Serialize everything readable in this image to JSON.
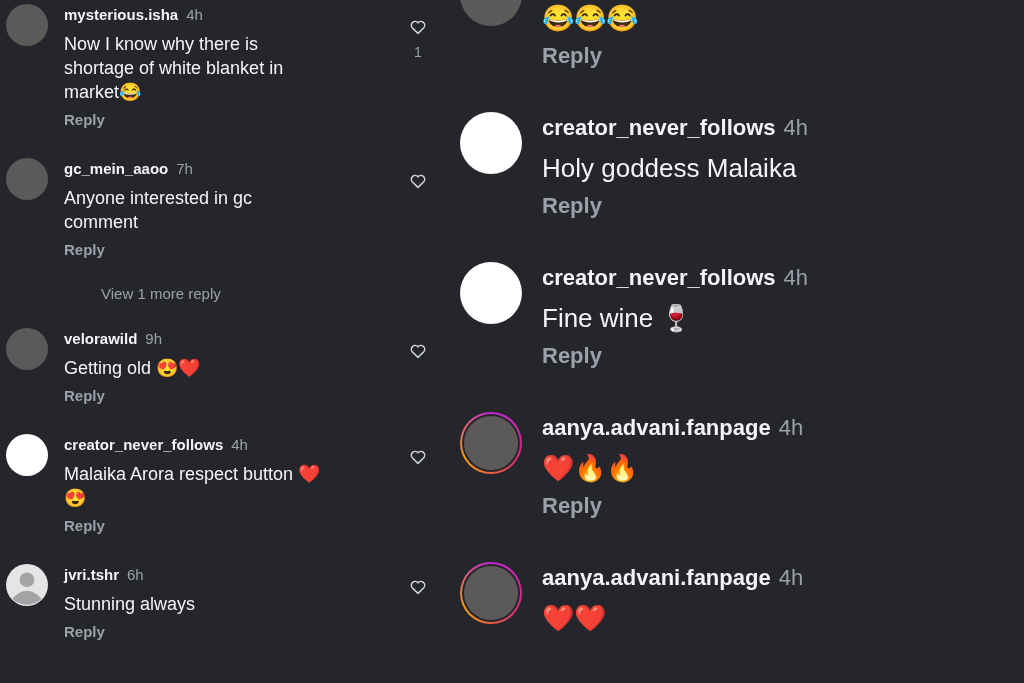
{
  "left_column": {
    "items": [
      {
        "kind": "comment",
        "username": "mysterious.isha",
        "time": "4h",
        "avatar": {
          "kind": "photo",
          "story_ring": false
        },
        "lines": [
          "Now I know why there is",
          "shortage of white blanket in",
          "market😂"
        ],
        "reply": "Reply",
        "liked": false,
        "like_count": "1"
      },
      {
        "kind": "comment",
        "username": "gc_mein_aaoo",
        "time": "7h",
        "avatar": {
          "kind": "photo",
          "story_ring": false
        },
        "lines": [
          "Anyone interested in gc",
          "comment"
        ],
        "reply": "Reply",
        "liked": false
      },
      {
        "kind": "more_replies",
        "text": "View 1 more reply"
      },
      {
        "kind": "comment",
        "username": "velorawild",
        "time": "9h",
        "avatar": {
          "kind": "photo",
          "story_ring": false
        },
        "lines": [
          "Getting old 😍❤️"
        ],
        "reply": "Reply",
        "liked": false
      },
      {
        "kind": "comment",
        "username": "creator_never_follows",
        "time": "4h",
        "avatar": {
          "kind": "blank",
          "story_ring": false
        },
        "lines": [
          "Malaika Arora respect button ❤️",
          "😍"
        ],
        "reply": "Reply",
        "liked": false
      },
      {
        "kind": "comment",
        "username": "jvri.tshr",
        "time": "6h",
        "avatar": {
          "kind": "default",
          "story_ring": false
        },
        "lines": [
          "Stunning always"
        ],
        "reply": "Reply",
        "liked": false
      }
    ]
  },
  "right_column": {
    "items": [
      {
        "kind": "comment",
        "avatar": {
          "kind": "photo",
          "story_ring": false
        },
        "lines": [
          "😂😂😂"
        ],
        "reply": "Reply"
      },
      {
        "kind": "comment",
        "username": "creator_never_follows",
        "time": "4h",
        "avatar": {
          "kind": "blank",
          "story_ring": false
        },
        "lines": [
          "Holy goddess Malaika"
        ],
        "reply": "Reply"
      },
      {
        "kind": "comment",
        "username": "creator_never_follows",
        "time": "4h",
        "avatar": {
          "kind": "blank",
          "story_ring": false
        },
        "lines": [
          "Fine wine 🍷"
        ],
        "reply": "Reply"
      },
      {
        "kind": "comment",
        "username": "aanya.advani.fanpage",
        "time": "4h",
        "avatar": {
          "kind": "photo",
          "story_ring": true
        },
        "lines": [
          "❤️🔥🔥"
        ],
        "reply": "Reply"
      },
      {
        "kind": "comment",
        "username": "aanya.advani.fanpage",
        "time": "4h",
        "avatar": {
          "kind": "photo",
          "story_ring": true
        },
        "lines": [
          "❤️❤️"
        ]
      }
    ]
  }
}
